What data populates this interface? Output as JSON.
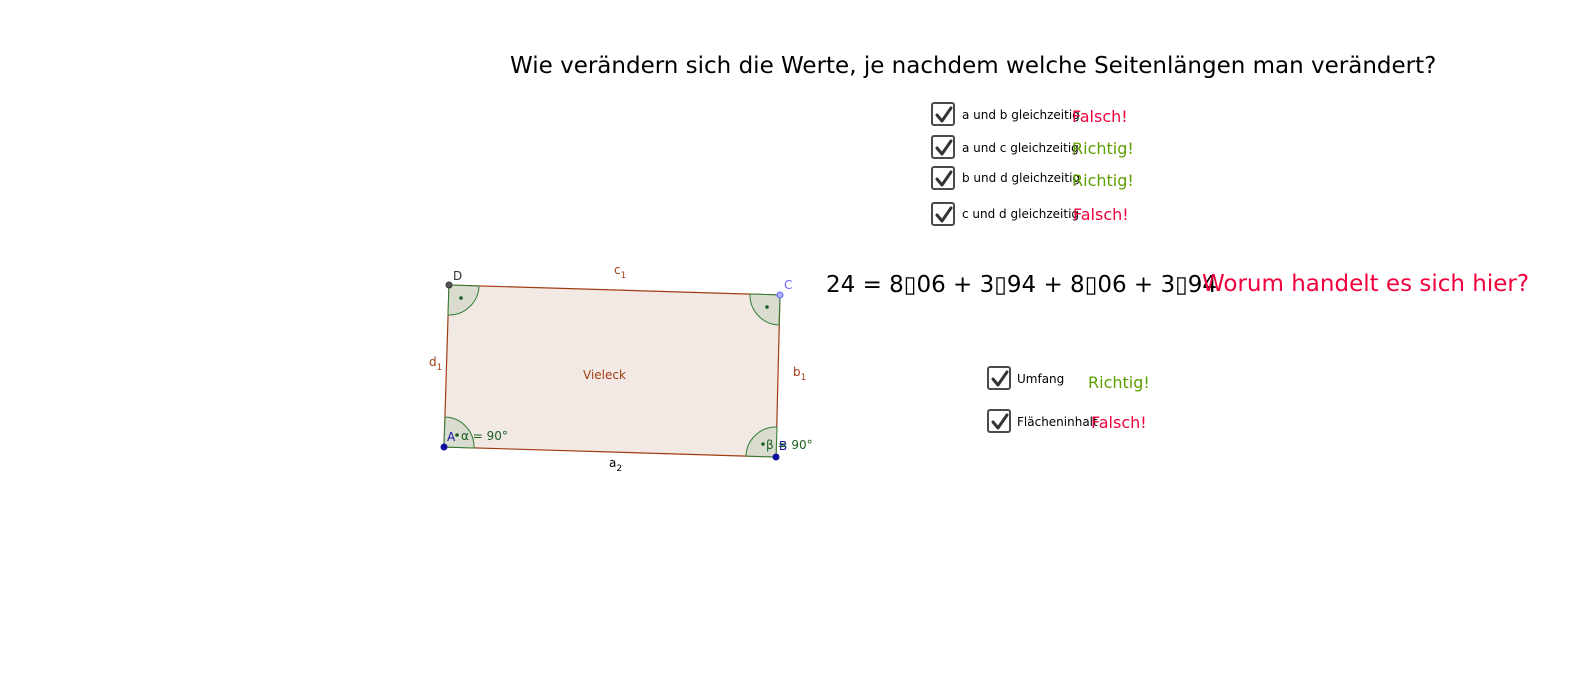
{
  "question": "Wie verändern sich die Werte, je nachdem welche Seitenlängen man verändert?",
  "side_options": [
    {
      "label": "a und b gleichzeitig",
      "checked": true,
      "result": "Falsch!",
      "correct": false
    },
    {
      "label": "a und c gleichzeitig",
      "checked": true,
      "result": "Richtig!",
      "correct": true
    },
    {
      "label": "b und d gleichzeitig",
      "checked": true,
      "result": "Richtig!",
      "correct": true
    },
    {
      "label": "c und d gleichzeitig",
      "checked": true,
      "result": "Falsch!",
      "correct": false
    }
  ],
  "equation": "24 = 8▯06 + 3▯94 + 8▯06 + 3▯94",
  "problem_question": "Worum handelt es sich hier?",
  "measure_options": [
    {
      "label": "Umfang",
      "checked": true,
      "result": "Richtig!",
      "correct": true
    },
    {
      "label": "Flächeninhalt",
      "checked": true,
      "result": "Falsch!",
      "correct": false
    }
  ],
  "figure": {
    "polygon_label": "Vieleck",
    "points": {
      "A": "A",
      "B": "B",
      "C": "C",
      "D": "D"
    },
    "sides": {
      "a": "a",
      "a_sub": "2",
      "b": "b",
      "b_sub": "1",
      "c": "c",
      "c_sub": "1",
      "d": "d",
      "d_sub": "1"
    },
    "angle_alpha": "α = 90°",
    "angle_beta": "β = 90°",
    "colors": {
      "fill": "#f3e9e4",
      "edge": "#a03c14",
      "angle_fill": "#d9dccf",
      "angle_edge": "#2e7d32",
      "point_blue": "#1010a0",
      "point_C": "#6a6aff",
      "point_D": "#444444"
    }
  },
  "colors": {
    "correct": "#5e9e00",
    "wrong": "#f0003c"
  }
}
